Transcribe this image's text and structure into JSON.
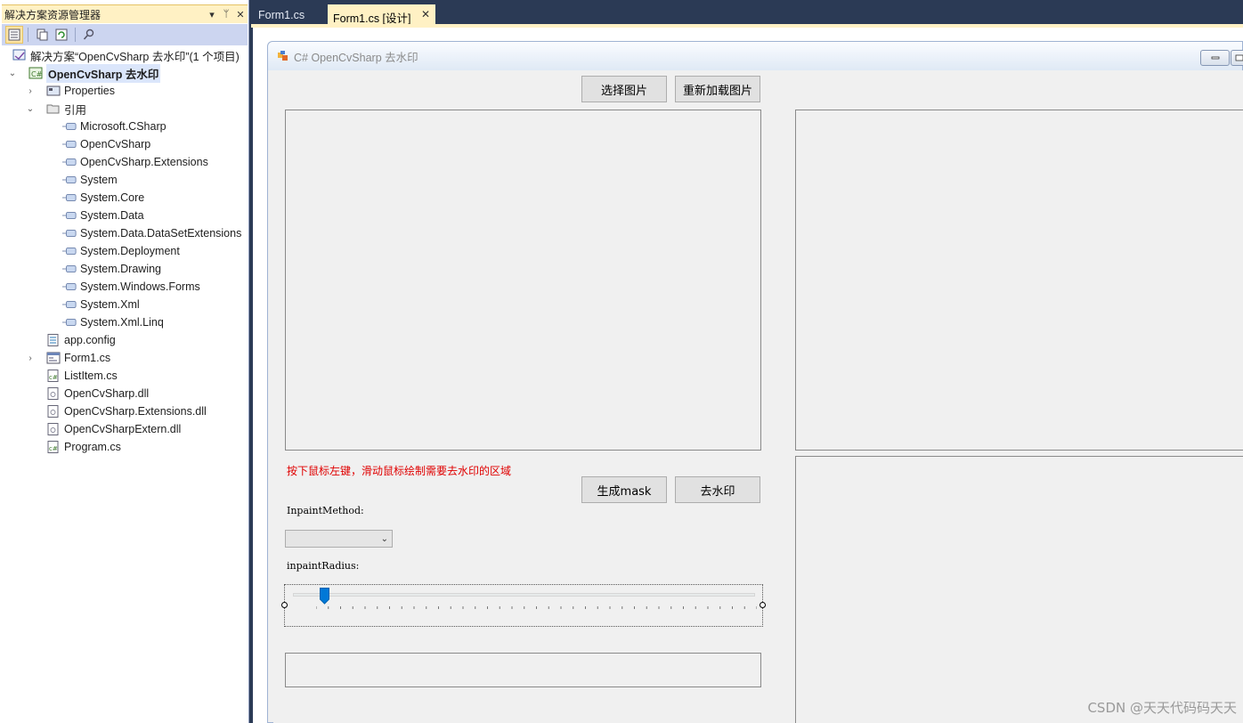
{
  "solution_explorer": {
    "title": "解决方案资源管理器",
    "title_controls": [
      "▾",
      "ᛘ",
      "✕"
    ],
    "solution_label": "解决方案“OpenCvSharp 去水印”(1 个项目)",
    "project_label": "OpenCvSharp 去水印",
    "items": [
      {
        "label": "Properties"
      },
      {
        "label": "引用"
      },
      {
        "label": "Microsoft.CSharp"
      },
      {
        "label": "OpenCvSharp"
      },
      {
        "label": "OpenCvSharp.Extensions"
      },
      {
        "label": "System"
      },
      {
        "label": "System.Core"
      },
      {
        "label": "System.Data"
      },
      {
        "label": "System.Data.DataSetExtensions"
      },
      {
        "label": "System.Deployment"
      },
      {
        "label": "System.Drawing"
      },
      {
        "label": "System.Windows.Forms"
      },
      {
        "label": "System.Xml"
      },
      {
        "label": "System.Xml.Linq"
      },
      {
        "label": "app.config"
      },
      {
        "label": "Form1.cs"
      },
      {
        "label": "ListItem.cs"
      },
      {
        "label": "OpenCvSharp.dll"
      },
      {
        "label": "OpenCvSharp.Extensions.dll"
      },
      {
        "label": "OpenCvSharpExtern.dll"
      },
      {
        "label": "Program.cs"
      }
    ]
  },
  "tabs": [
    {
      "label": "Form1.cs"
    },
    {
      "label": "Form1.cs [设计]"
    }
  ],
  "form": {
    "title": "C# OpenCvSharp 去水印",
    "select_image_button": "选择图片",
    "reload_image_button": "重新加载图片",
    "hint_text": "按下鼠标左键，滑动鼠标绘制需要去水印的区域",
    "generate_mask_button": "生成mask",
    "remove_watermark_button": "去水印",
    "inpaint_method_label": "InpaintMethod:",
    "inpaint_method_value": "",
    "inpaint_radius_label": "inpaintRadius:",
    "inpaint_radius_fraction": 0.05,
    "tick_count": 37
  },
  "watermark": "CSDN @天天代码码天天",
  "colors": {
    "hint": "#e00000",
    "thumb": "#0078d7",
    "active_tab": "#fff1c4"
  }
}
